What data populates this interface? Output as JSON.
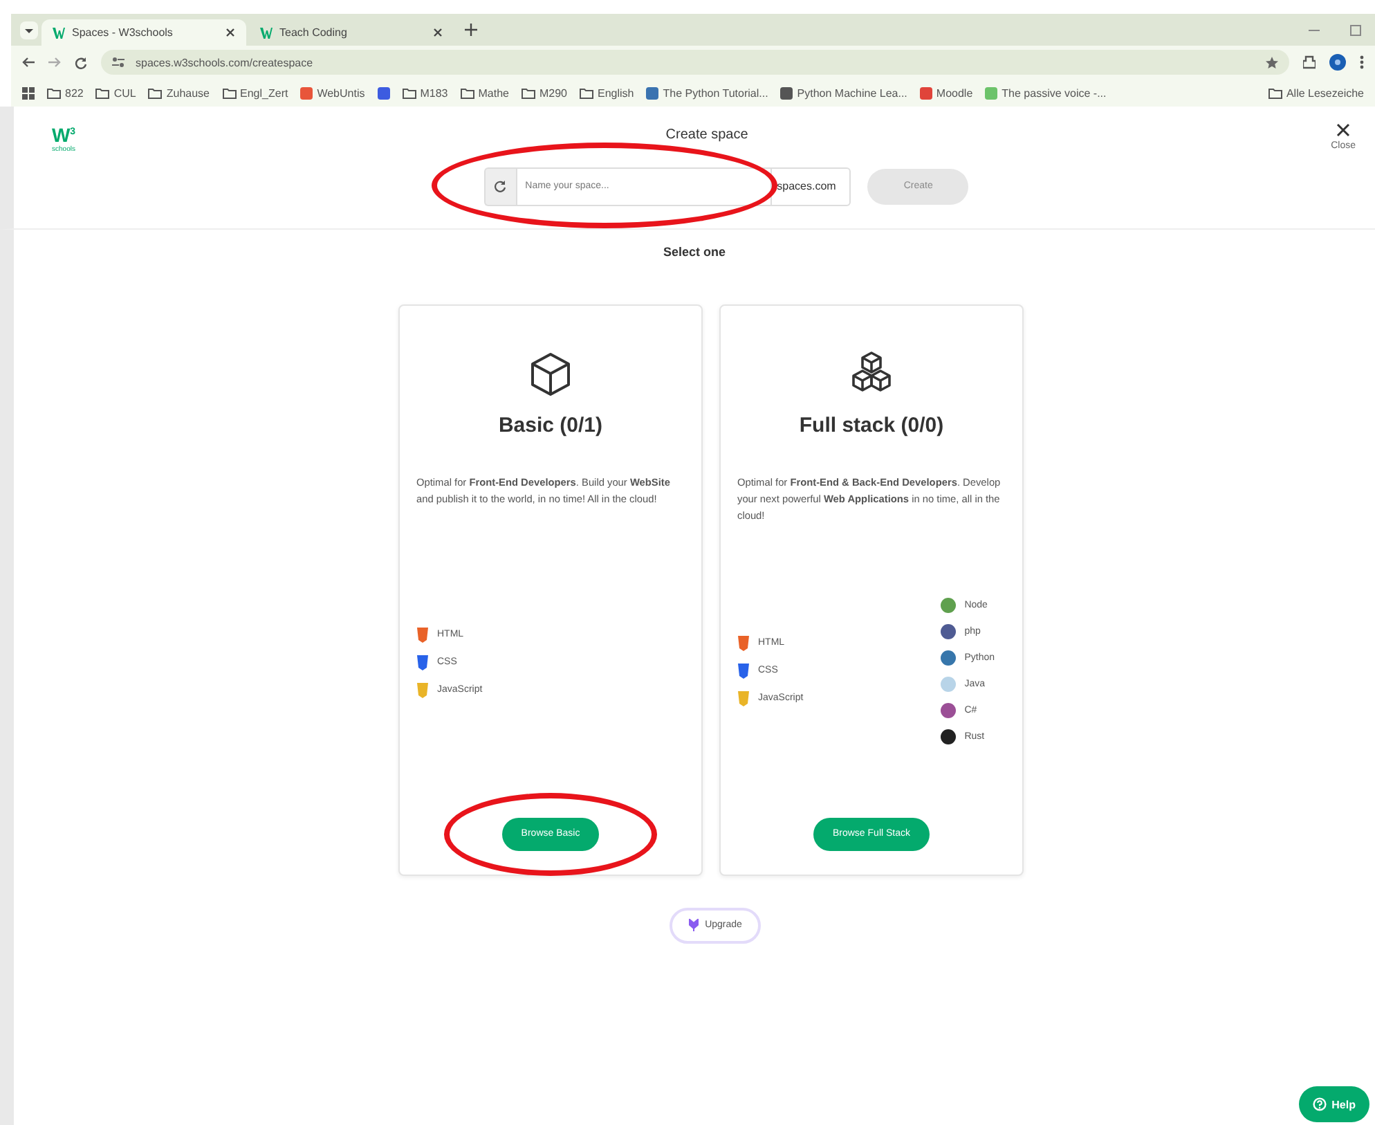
{
  "browser": {
    "tabs": [
      {
        "title": "Spaces - W3schools",
        "selected": true
      },
      {
        "title": "Teach Coding",
        "selected": false
      }
    ],
    "url": "spaces.w3schools.com/createspace",
    "bookmarks": [
      {
        "label": "822",
        "kind": "folder"
      },
      {
        "label": "CUL",
        "kind": "folder"
      },
      {
        "label": "Zuhause",
        "kind": "folder"
      },
      {
        "label": "Engl_Zert",
        "kind": "folder"
      },
      {
        "label": "WebUntis",
        "kind": "site",
        "color": "#e8553a"
      },
      {
        "kind": "site",
        "color": "#3d5ce0"
      },
      {
        "label": "M183",
        "kind": "folder"
      },
      {
        "label": "Mathe",
        "kind": "folder"
      },
      {
        "label": "M290",
        "kind": "folder"
      },
      {
        "label": "English",
        "kind": "folder"
      },
      {
        "label": "The Python Tutorial...",
        "kind": "site",
        "color": "#3a73b0"
      },
      {
        "label": "Python Machine Lea...",
        "kind": "site",
        "color": "#555555"
      },
      {
        "label": "Moodle",
        "kind": "site",
        "color": "#e0443a"
      },
      {
        "label": "The passive voice -...",
        "kind": "site",
        "color": "#6cc36a"
      }
    ],
    "all_bookmarks": "Alle Lesezeiche"
  },
  "header": {
    "logo": "W",
    "logo_sup": "3",
    "logo_sub": "schools",
    "title": "Create space",
    "close": "Close"
  },
  "space_name": {
    "placeholder": "Name your space...",
    "suffix": "spaces.com",
    "circled": true
  },
  "create_button": {
    "label": "Create",
    "disabled": true
  },
  "prompt": "Select one",
  "cards": [
    {
      "title": "Basic (0/1)",
      "kind": "single",
      "description": "Optimal for **Front-End Developers**. Build your **WebSite** and publish it to the world, in no time! All in the cloud!",
      "tech_columns": [
        [
          {
            "label": "HTML",
            "kind": "shield",
            "color": "#e96228"
          },
          {
            "label": "CSS",
            "kind": "shield",
            "color": "#2862e9"
          },
          {
            "label": "JavaScript",
            "kind": "shield",
            "color": "#e9b428"
          }
        ]
      ],
      "button": {
        "label": "Browse Basic",
        "circled": true
      }
    },
    {
      "title": "Full stack (0/0)",
      "kind": "stack",
      "description": "Optimal for **Front-End & Back-End Developers**. Develop your next powerful **Web Applications** in no time, all in the cloud!",
      "tech_columns": [
        [
          {
            "label": "HTML",
            "kind": "shield",
            "color": "#e96228"
          },
          {
            "label": "CSS",
            "kind": "shield",
            "color": "#2862e9"
          },
          {
            "label": "JavaScript",
            "kind": "shield",
            "color": "#e9b428"
          }
        ],
        [
          {
            "label": "Node",
            "kind": "circle",
            "color": "#5fa04e"
          },
          {
            "label": "php",
            "kind": "circle",
            "color": "#4f5b93"
          },
          {
            "label": "Python",
            "kind": "circle",
            "color": "#3776ab"
          },
          {
            "label": "Java",
            "kind": "circle",
            "color": "#b8d4e8"
          },
          {
            "label": "C#",
            "kind": "circle",
            "color": "#9b4f96"
          },
          {
            "label": "Rust",
            "kind": "circle",
            "color": "#222222"
          }
        ]
      ],
      "button": {
        "label": "Browse Full Stack",
        "circled": false
      }
    }
  ],
  "upgrade": "Upgrade",
  "help": "Help"
}
